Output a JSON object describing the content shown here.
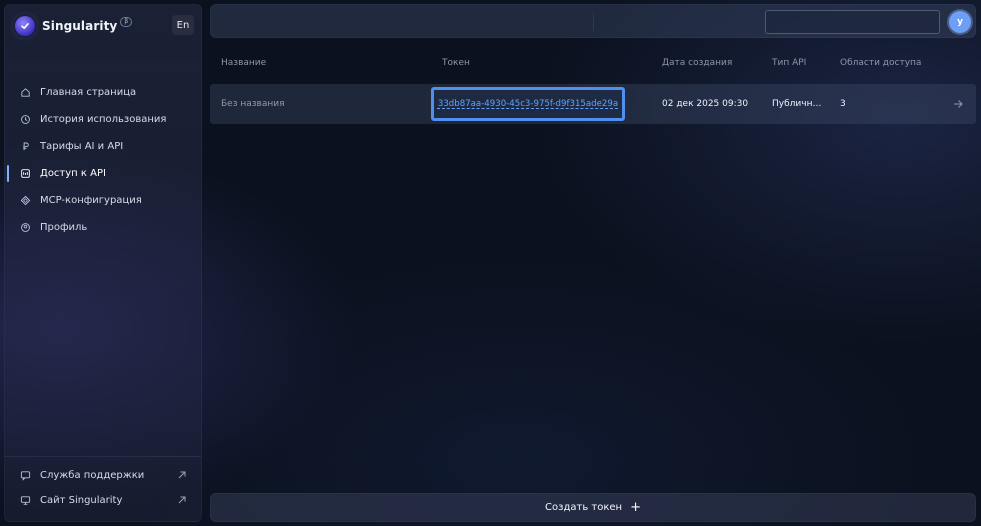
{
  "brand": {
    "name": "Singularity",
    "badge": "β",
    "lang": "En"
  },
  "nav": [
    {
      "label": "Главная страница",
      "icon": "home-icon"
    },
    {
      "label": "История использования",
      "icon": "clock-icon"
    },
    {
      "label": "Тарифы AI и API",
      "icon": "ruble-icon"
    },
    {
      "label": "Доступ к API",
      "icon": "api-key-icon",
      "active": true
    },
    {
      "label": "MCP-конфигурация",
      "icon": "mcp-icon"
    },
    {
      "label": "Профиль",
      "icon": "profile-icon"
    }
  ],
  "bottom_links": [
    {
      "label": "Служба поддержки",
      "icon": "chat-icon"
    },
    {
      "label": "Сайт Singularity",
      "icon": "monitor-icon"
    }
  ],
  "topbar": {
    "search_value": "",
    "avatar_initial": "y"
  },
  "table": {
    "columns": [
      "Название",
      "Токен",
      "Дата создания",
      "Тип API",
      "Области доступа"
    ],
    "rows": [
      {
        "name": "Без названия",
        "token": "33db87aa-4930-45c3-975f-d9f315ade29a",
        "created": "02 дек 2025 09:30",
        "api_type": "Публичн…",
        "scopes": "3"
      }
    ]
  },
  "actions": {
    "create_token": "Создать токен",
    "create_icon": "+"
  },
  "colors": {
    "accent": "#4f8fee",
    "link": "#5fa2ff",
    "avatar": "#6d9ff5"
  }
}
